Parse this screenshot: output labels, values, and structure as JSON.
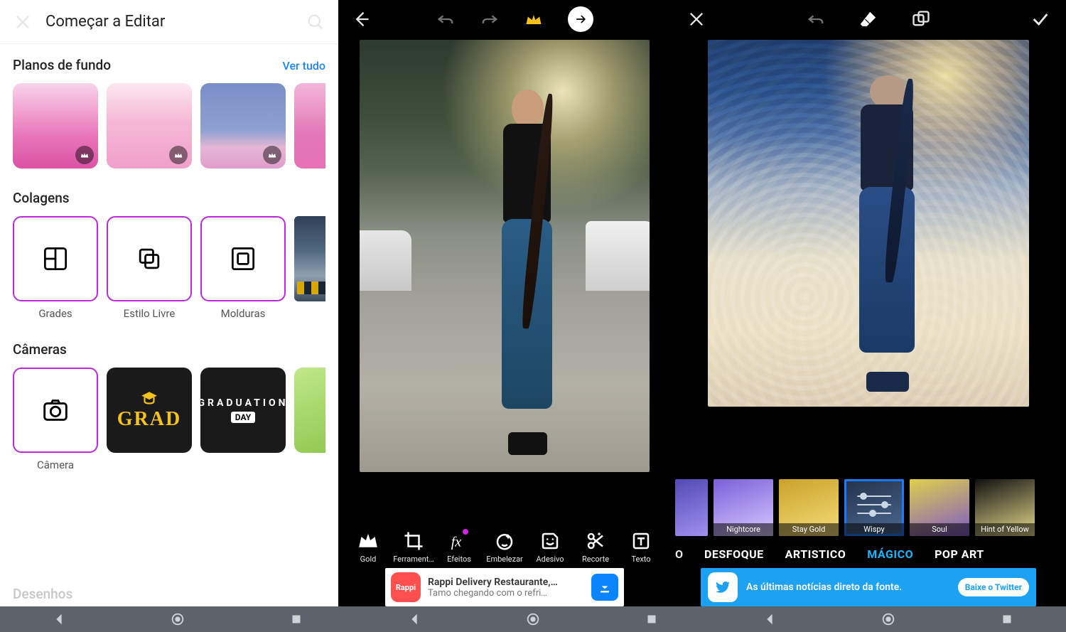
{
  "screen1": {
    "title": "Começar a Editar",
    "sections": {
      "backgrounds": {
        "title": "Planos de fundo",
        "see_all": "Ver tudo"
      },
      "collages": {
        "title": "Colagens",
        "items": [
          "Grades",
          "Estilo Livre",
          "Molduras"
        ]
      },
      "cameras": {
        "title": "Câmeras",
        "camera_label": "Câmera",
        "cards": {
          "grad": "GRAD",
          "gradday_top": "GRADUATION",
          "gradday_banner": "DAY"
        }
      },
      "cutoff": "Desenhos"
    }
  },
  "screen2": {
    "tools": [
      "Gold",
      "Ferrament…",
      "Efeitos",
      "Embelezar",
      "Adesivo",
      "Recorte",
      "Texto"
    ],
    "ad": {
      "brand": "Rappi",
      "title": "Rappi Delivery Restaurante,…",
      "subtitle": "Tamo chegando com o refri…"
    }
  },
  "screen3": {
    "filters": [
      "Nightcore",
      "Stay Gold",
      "Wispy",
      "Soul",
      "Hint of Yellow"
    ],
    "categories_partial": "O",
    "categories": [
      "DESFOQUE",
      "ARTISTICO",
      "MÁGICO",
      "POP ART"
    ],
    "active_category": "MÁGICO",
    "ad": {
      "text": "As últimas notícias direto da fonte.",
      "cta": "Baixe o Twitter"
    }
  }
}
